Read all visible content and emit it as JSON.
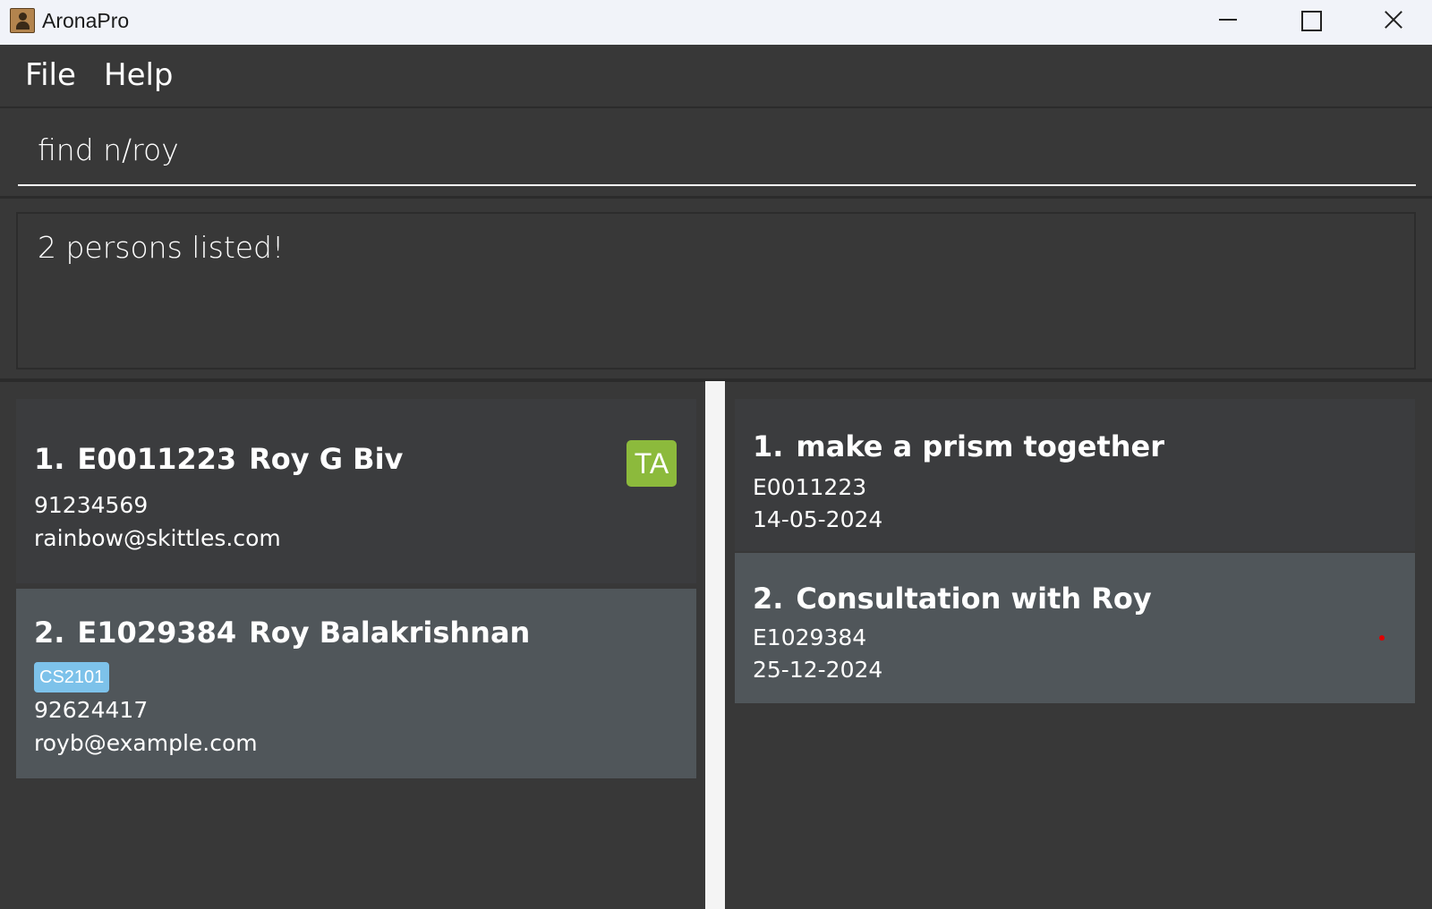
{
  "window": {
    "title": "AronaPro"
  },
  "menu": {
    "file": "File",
    "help": "Help"
  },
  "command": {
    "value": "find n/roy"
  },
  "result": {
    "message": "2 persons listed!"
  },
  "persons": [
    {
      "index": "1.",
      "id": "E0011223",
      "name": "Roy G Biv",
      "role_badge": "TA",
      "phone": "91234569",
      "email": "rainbow@skittles.com"
    },
    {
      "index": "2.",
      "id": "E1029384",
      "name": "Roy Balakrishnan",
      "tag": "CS2101",
      "phone": "92624417",
      "email": "royb@example.com"
    }
  ],
  "consultations": [
    {
      "index": "1.",
      "title": "make a prism together",
      "id": "E0011223",
      "date": "14-05-2024"
    },
    {
      "index": "2.",
      "title": "Consultation with Roy",
      "id": "E1029384",
      "date": "25-12-2024"
    }
  ],
  "colors": {
    "background": "#383838",
    "card_dark": "#3b3c3e",
    "card_selected": "#50565a",
    "ta_badge": "#8cba3c",
    "tag_chip": "#7dc2ea"
  }
}
